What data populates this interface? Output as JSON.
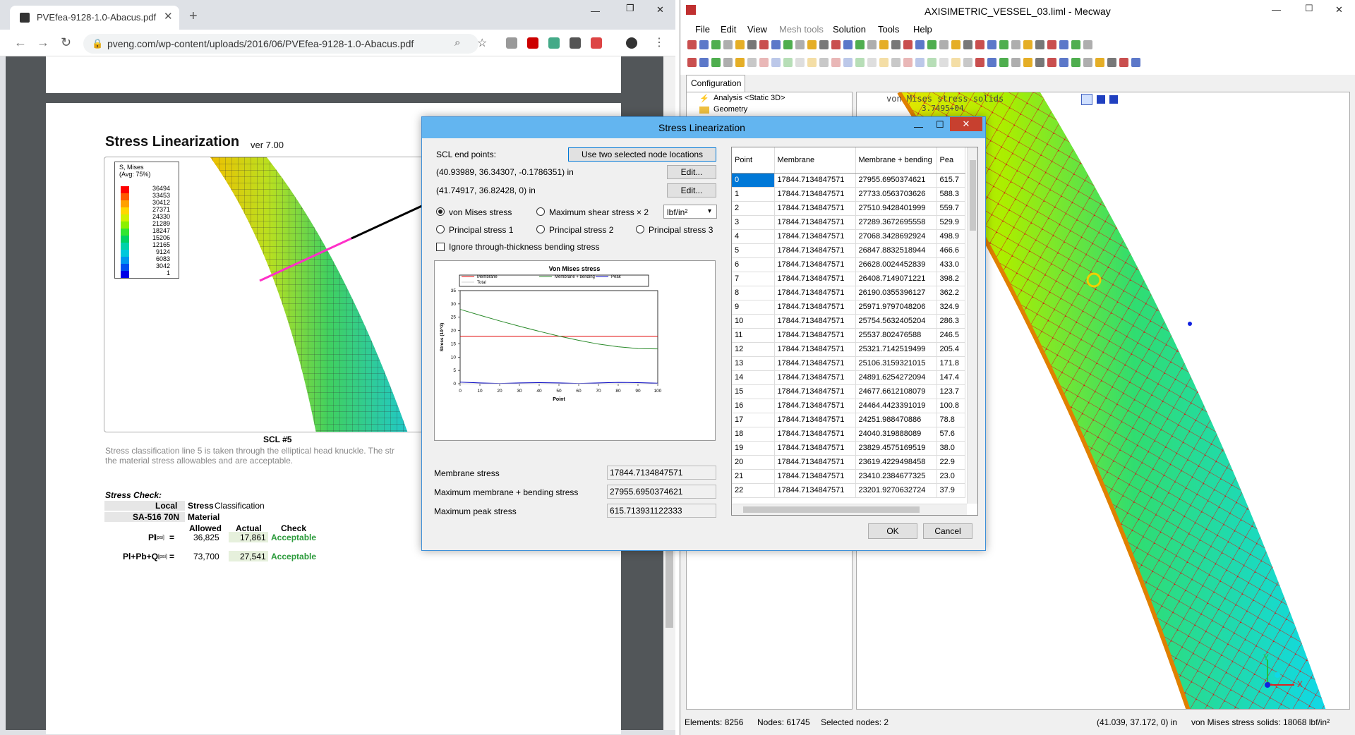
{
  "chrome": {
    "tab_title": "PVEfea-9128-1.0-Abacus.pdf",
    "url": "pveng.com/wp-content/uploads/2016/06/PVEfea-9128-1.0-Abacus.pdf",
    "pdf": {
      "heading": "Stress Linearization",
      "heading_ver": "ver 7.00",
      "legend_title": "S, Mises",
      "legend_avg": "(Avg: 75%)",
      "legend_values": [
        "36494",
        "33453",
        "30412",
        "27371",
        "24330",
        "21289",
        "18247",
        "15206",
        "12165",
        "9124",
        "6083",
        "3042",
        "1"
      ],
      "legend_colors": [
        "#ff0000",
        "#ff5a00",
        "#ffa000",
        "#ffd700",
        "#d2f000",
        "#8cf000",
        "#32e632",
        "#00d264",
        "#00d2aa",
        "#00c8dc",
        "#0096f0",
        "#0050f0",
        "#0000e6"
      ],
      "scl_label": "SCL #5",
      "caption1": "Stress classification line 5 is taken through the elliptical head knuckle.  The str",
      "caption2": "the material stress allowables and are acceptable.",
      "stress_check": "Stress Check:",
      "local": "Local",
      "stress_class_a": "Stress",
      "stress_class_b": " Classification",
      "material_code": "SA-516 70N",
      "material": "Material",
      "col_allowed": "Allowed",
      "col_actual": "Actual",
      "col_check": "Check",
      "row1_label": "Pl",
      "row1_unit": "[psi]",
      "row1_allowed": "36,825",
      "row1_actual": "17,861",
      "row1_check": "Acceptable",
      "row2_label": "Pl+Pb+Q",
      "row2_unit": "[psi]",
      "row2_allowed": "73,700",
      "row2_actual": "27,541",
      "row2_check": "Acceptable"
    }
  },
  "mecway": {
    "title": "AXISIMETRIC_VESSEL_03.liml - Mecway",
    "menu": [
      "File",
      "Edit",
      "View",
      "Mesh tools",
      "Solution",
      "Tools",
      "Help"
    ],
    "config_tab": "Configuration",
    "tree": [
      "Analysis <Static 3D>",
      "Geometry"
    ],
    "viewport_label1": "von Mises stress solids",
    "viewport_label2": "3.7495+04",
    "status_elements": "Elements: 8256",
    "status_nodes": "Nodes: 61745",
    "status_selected": "Selected nodes: 2",
    "status_coords": "(41.039, 37.172, 0) in",
    "status_value": "von Mises stress solids: 18068 lbf/in²",
    "axis_x": "X",
    "axis_y": "Y"
  },
  "dialog": {
    "title": "Stress Linearization",
    "scl_end_points": "SCL end points:",
    "use_nodes_btn": "Use two selected node locations",
    "point1": "(40.93989, 36.34307, -0.1786351) in",
    "point2": "(41.74917, 36.82428, 0) in",
    "edit_btn": "Edit...",
    "radio_vm": "von Mises stress",
    "radio_shear": "Maximum shear stress × 2",
    "unit": "lbf/in²",
    "radio_p1": "Principal stress 1",
    "radio_p2": "Principal stress 2",
    "radio_p3": "Principal stress 3",
    "ignore_label": "Ignore through-thickness bending stress",
    "membrane_label": "Membrane stress",
    "membrane_value": "17844.7134847571",
    "max_mb_label": "Maximum membrane + bending stress",
    "max_mb_value": "27955.6950374621",
    "max_peak_label": "Maximum peak stress",
    "max_peak_value": "615.713931122333",
    "ok": "OK",
    "cancel": "Cancel",
    "table_headers": [
      "Point",
      "Membrane",
      "Membrane + bending",
      "Pea"
    ],
    "table_rows": [
      [
        "0",
        "17844.7134847571",
        "27955.6950374621",
        "615.7"
      ],
      [
        "1",
        "17844.7134847571",
        "27733.0563703626",
        "588.3"
      ],
      [
        "2",
        "17844.7134847571",
        "27510.9428401999",
        "559.7"
      ],
      [
        "3",
        "17844.7134847571",
        "27289.3672695558",
        "529.9"
      ],
      [
        "4",
        "17844.7134847571",
        "27068.3428692924",
        "498.9"
      ],
      [
        "5",
        "17844.7134847571",
        "26847.8832518944",
        "466.6"
      ],
      [
        "6",
        "17844.7134847571",
        "26628.0024452839",
        "433.0"
      ],
      [
        "7",
        "17844.7134847571",
        "26408.7149071221",
        "398.2"
      ],
      [
        "8",
        "17844.7134847571",
        "26190.0355396127",
        "362.2"
      ],
      [
        "9",
        "17844.7134847571",
        "25971.9797048206",
        "324.9"
      ],
      [
        "10",
        "17844.7134847571",
        "25754.5632405204",
        "286.3"
      ],
      [
        "11",
        "17844.7134847571",
        "25537.802476588",
        "246.5"
      ],
      [
        "12",
        "17844.7134847571",
        "25321.7142519499",
        "205.4"
      ],
      [
        "13",
        "17844.7134847571",
        "25106.3159321015",
        "171.8"
      ],
      [
        "14",
        "17844.7134847571",
        "24891.6254272094",
        "147.4"
      ],
      [
        "15",
        "17844.7134847571",
        "24677.6612108079",
        "123.7"
      ],
      [
        "16",
        "17844.7134847571",
        "24464.4423391019",
        "100.8"
      ],
      [
        "17",
        "17844.7134847571",
        "24251.988470886",
        "78.8"
      ],
      [
        "18",
        "17844.7134847571",
        "24040.319888089",
        "57.6"
      ],
      [
        "19",
        "17844.7134847571",
        "23829.4575169519",
        "38.0"
      ],
      [
        "20",
        "17844.7134847571",
        "23619.4229498458",
        "22.9"
      ],
      [
        "21",
        "17844.7134847571",
        "23410.2384677325",
        "23.0"
      ],
      [
        "22",
        "17844.7134847571",
        "23201.9270632724",
        "37.9"
      ]
    ]
  },
  "chart_data": {
    "type": "line",
    "title": "Von Mises stress",
    "xlabel": "Point",
    "ylabel": "Stress (10^3)",
    "xlim": [
      0,
      100
    ],
    "ylim": [
      0,
      35
    ],
    "xticks": [
      0,
      10,
      20,
      30,
      40,
      50,
      60,
      70,
      80,
      90,
      100
    ],
    "yticks": [
      0,
      5,
      10,
      15,
      20,
      25,
      30,
      35
    ],
    "legend": [
      "Membrane",
      "Membrane + bending",
      "Peak",
      "Total"
    ],
    "legend_position": "top",
    "series": [
      {
        "name": "Membrane",
        "color": "#e00000",
        "x": [
          0,
          100
        ],
        "y": [
          17.84,
          17.84
        ]
      },
      {
        "name": "Membrane + bending",
        "color": "#2a8a2a",
        "x": [
          0,
          10,
          20,
          30,
          40,
          50,
          60,
          70,
          80,
          90,
          100
        ],
        "y": [
          27.96,
          25.75,
          23.62,
          21.6,
          19.7,
          17.9,
          16.3,
          14.9,
          13.9,
          13.2,
          13.1
        ]
      },
      {
        "name": "Peak",
        "color": "#0000c0",
        "x": [
          0,
          10,
          20,
          30,
          40,
          50,
          60,
          70,
          80,
          90,
          100
        ],
        "y": [
          0.6,
          0.29,
          0.1,
          0.3,
          0.4,
          0.3,
          0.1,
          0.3,
          0.5,
          0.4,
          0.2
        ]
      },
      {
        "name": "Total",
        "color": "#d0d0d0",
        "x": [
          0,
          100
        ],
        "y": [
          0,
          0
        ]
      }
    ]
  }
}
